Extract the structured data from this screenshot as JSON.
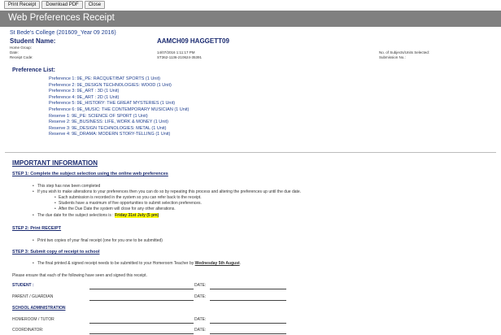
{
  "toolbar": {
    "print_label": "Print Receipt",
    "download_label": "Download PDF",
    "close_label": "Close"
  },
  "header": {
    "title": "Web Preferences Receipt"
  },
  "receipt": {
    "school": "St Bede's College (201609_Year 09 2016)",
    "student_label": "Student Name:",
    "student_value": "AAMCH09 HAGGETT09",
    "home_group_label": "Home Group:",
    "date_label": "Date:",
    "date_value": "14/07/2016 1:11:17 PM",
    "receipt_code_label": "Receipt Code:",
    "receipt_code_value": "ST362-1136-210624-35391",
    "subjects_selected_label": "No. of Subjects/Units Selected:",
    "submission_label": "Submission No.:"
  },
  "preferences": {
    "heading": "Preference List:",
    "items": [
      "Preference 1: 9E_PE: RACQUET/BAT SPORTS (1 Unit)",
      "Preference 2: 9E_DESIGN TECHNOLOGIES: WOOD (1 Unit)",
      "Preference 3: 9E_ART : 3D (1 Unit)",
      "Preference 4: 9E_ART : 2D (1 Unit)",
      "Preference 5: 9E_HISTORY: THE GREAT MYSTERIES (1 Unit)",
      "Preference 6: 9E_MUSIC: THE CONTEMPORARY MUSICIAN (1 Unit)",
      "Reserve 1: 9E_PE: SCIENCE OF SPORT (1 Unit)",
      "Reserve 2: 9E_BUSINESS: LIFE, WORK & MONEY (1 Unit)",
      "Reserve 3: 9E_DESIGN TECHNOLOGIES: METAL (1 Unit)",
      "Reserve 4: 9E_DRAMA: MODERN STORY-TELLING (1 Unit)"
    ]
  },
  "info": {
    "heading": "IMPORTANT INFORMATION",
    "step1": {
      "title": "STEP 1: Complete the subject selection using the online web preferences",
      "b1": "This step has now been completed",
      "b2": "If you wish to make alterations to your preferences then you can do so by repeating this process and altering the preferences up until the due date.",
      "s1": "Each submission is recorded in the system so you can refer back to the receipt.",
      "s2": "Students have a maximum of five opportunities to submit selection preferences.",
      "s3": "After the Due Date the system will close for any other alterations.",
      "b3_prefix": "The due date for the subject selections is :",
      "b3_date": "Friday 31st July (5 pm)"
    },
    "step2": {
      "title": "STEP 2: Print RECEIPT",
      "b1": "Print two copies of your final receipt (one for you one to be submitted)"
    },
    "step3": {
      "title": "STEP 3: Submit copy of receipt to school",
      "b1_prefix": "The final printed & signed receipt needs to be submitted to your Homeroom Teacher by",
      "b1_date": "Wednesday 5th August",
      "b1_suffix": "."
    },
    "ensure_text": "Please ensure that each of the following have seen and signed this receipt."
  },
  "signatures": {
    "student": "STUDENT :",
    "parent": "PARENT / GUARDIAN",
    "school_admin": "SCHOOL ADMINISTRATION",
    "homeroom": "HOMEROOM / TUTOR",
    "coordinator": "COORDINATOR:",
    "date": "DATE:"
  }
}
